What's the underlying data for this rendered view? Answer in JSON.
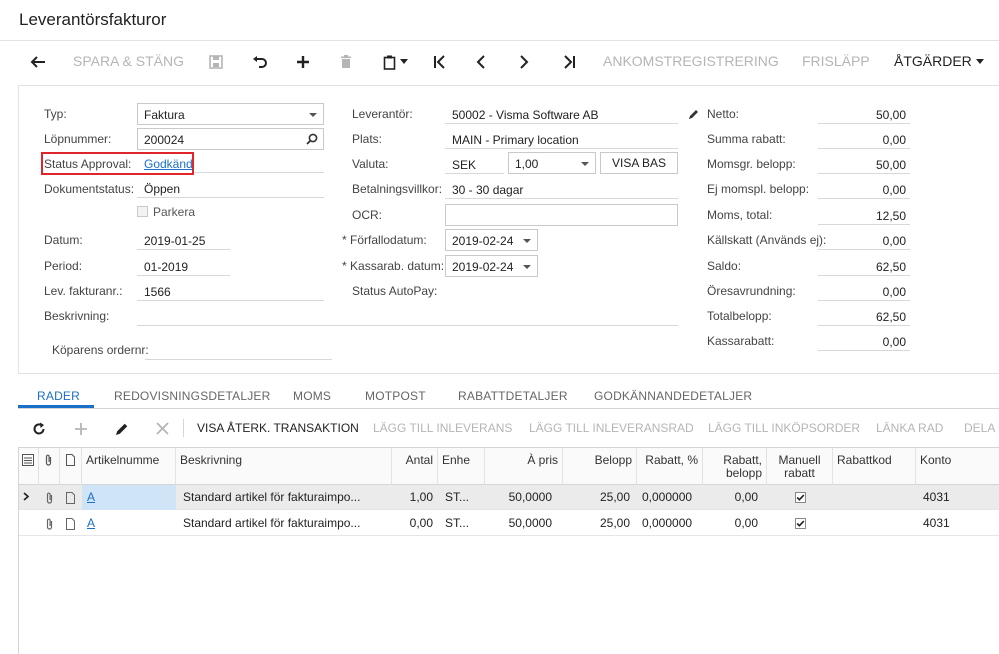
{
  "page": {
    "title": "Leverantörsfakturor"
  },
  "toolbar": {
    "save_close": "SPARA & STÄNG",
    "arrival": "ANKOMSTREGISTRERING",
    "release": "FRISLÄPP",
    "actions": "ÅTGÄRDER"
  },
  "form": {
    "typ_label": "Typ:",
    "typ_value": "Faktura",
    "lopnummer_label": "Löpnummer:",
    "lopnummer_value": "200024",
    "status_approval_label": "Status Approval:",
    "status_approval_value": "Godkänd",
    "dokumentstatus_label": "Dokumentstatus:",
    "dokumentstatus_value": "Öppen",
    "parkera_label": "Parkera",
    "datum_label": "Datum:",
    "datum_value": "2019-01-25",
    "period_label": "Period:",
    "period_value": "01-2019",
    "levfaktura_label": "Lev. fakturanr.:",
    "levfaktura_value": "1566",
    "beskrivning_label": "Beskrivning:",
    "beskrivning_value": "",
    "koparens_label": "Köparens ordernr:",
    "koparens_value": "",
    "leverantor_label": "Leverantör:",
    "leverantor_value": "50002 - Visma Software AB",
    "plats_label": "Plats:",
    "plats_value": "MAIN - Primary location",
    "valuta_label": "Valuta:",
    "valuta_value": "SEK",
    "kurs_value": "1,00",
    "visa_bas": "VISA BAS",
    "betalningsvillkor_label": "Betalningsvillkor:",
    "betalningsvillkor_value": "30 - 30 dagar",
    "ocr_label": "OCR:",
    "ocr_value": "",
    "forfallodatum_label": "Förfallodatum:",
    "forfallodatum_value": "2019-02-24",
    "kassarab_label": "Kassarab. datum:",
    "kassarab_value": "2019-02-24",
    "autopay_label": "Status AutoPay:",
    "required_marker": "*"
  },
  "totals": {
    "netto_label": "Netto:",
    "netto": "50,00",
    "rabatt_label": "Summa rabatt:",
    "rabatt": "0,00",
    "momsgr_label": "Momsgr. belopp:",
    "momsgr": "50,00",
    "ejmoms_label": "Ej momspl. belopp:",
    "ejmoms": "0,00",
    "moms_label": "Moms, total:",
    "moms": "12,50",
    "kallskatt_label": "Källskatt (Används ej):",
    "kallskatt": "0,00",
    "saldo_label": "Saldo:",
    "saldo": "62,50",
    "ores_label": "Öresavrundning:",
    "ores": "0,00",
    "total_label": "Totalbelopp:",
    "total": "62,50",
    "kassarabatt_label": "Kassarabatt:",
    "kassarabatt": "0,00"
  },
  "tabs": [
    "RADER",
    "REDOVISNINGSDETALJER",
    "MOMS",
    "MOTPOST",
    "RABATTDETALJER",
    "GODKÄNNANDEDETALJER"
  ],
  "gridbar": {
    "visa": "VISA ÅTERK. TRANSAKTION",
    "lagg_inleverans": "LÄGG TILL INLEVERANS",
    "lagg_inleveransrad": "LÄGG TILL INLEVERANSRAD",
    "lagg_inkopsorder": "LÄGG TILL INKÖPSORDER",
    "lanka": "LÄNKA RAD",
    "dela": "DELA U"
  },
  "grid": {
    "headers": {
      "artikel": "Artikelnumme",
      "beskrivning": "Beskrivning",
      "antal": "Antal",
      "enhet": "Enhe",
      "apris": "À pris",
      "belopp": "Belopp",
      "rabatt_pct": "Rabatt, %",
      "rabatt_belopp": "Rabatt, belopp",
      "manuell": "Manuell rabatt",
      "rabattkod": "Rabattkod",
      "konto": "Konto"
    },
    "rows": [
      {
        "artikel": "A",
        "beskrivning": "Standard artikel för fakturaimpo...",
        "antal": "1,00",
        "enhet": "ST...",
        "apris": "50,0000",
        "belopp": "25,00",
        "rabatt_pct": "0,000000",
        "rabatt_belopp": "0,00",
        "konto": "4031"
      },
      {
        "artikel": "A",
        "beskrivning": "Standard artikel för fakturaimpo...",
        "antal": "0,00",
        "enhet": "ST...",
        "apris": "50,0000",
        "belopp": "25,00",
        "rabatt_pct": "0,000000",
        "rabatt_belopp": "0,00",
        "konto": "4031"
      }
    ]
  }
}
